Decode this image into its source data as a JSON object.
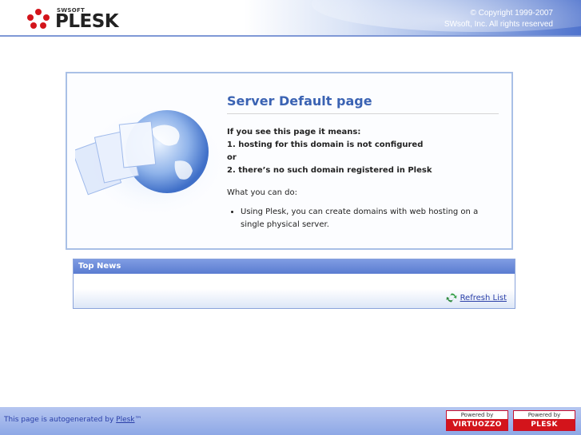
{
  "header": {
    "brand_small": "SWSOFT",
    "brand": "PLESK",
    "copyright_line1": "© Copyright 1999-2007",
    "copyright_line2": "SWsoft, Inc. All rights reserved"
  },
  "main": {
    "title": "Server Default page",
    "intro": "If you see this page it means:",
    "reason1": "1. hosting for this domain is not configured",
    "or": "or",
    "reason2": "2. there’s no such domain registered in Plesk",
    "what_you_can_do": "What you can do:",
    "bullets": [
      "Using Plesk, you can create domains with web hosting on a single physical server."
    ]
  },
  "news": {
    "title": "Top News",
    "refresh_label": "Refresh List"
  },
  "footer": {
    "text_prefix": "This page is autogenerated by",
    "link_text": "Plesk",
    "trademark": "™",
    "badges": [
      {
        "powered_by": "Powered by",
        "name": "VIRTUOZZO"
      },
      {
        "powered_by": "Powered by",
        "name": "PLESK"
      }
    ]
  },
  "colors": {
    "accent": "#3b63b3",
    "brand_red": "#d3141b",
    "panel_border": "#a9c0e6",
    "news_header": "#6b8ad8"
  },
  "icons": {
    "logo": "plesk-dots-logo",
    "art": "globe-pages-illustration",
    "refresh": "refresh-arrows-icon"
  }
}
